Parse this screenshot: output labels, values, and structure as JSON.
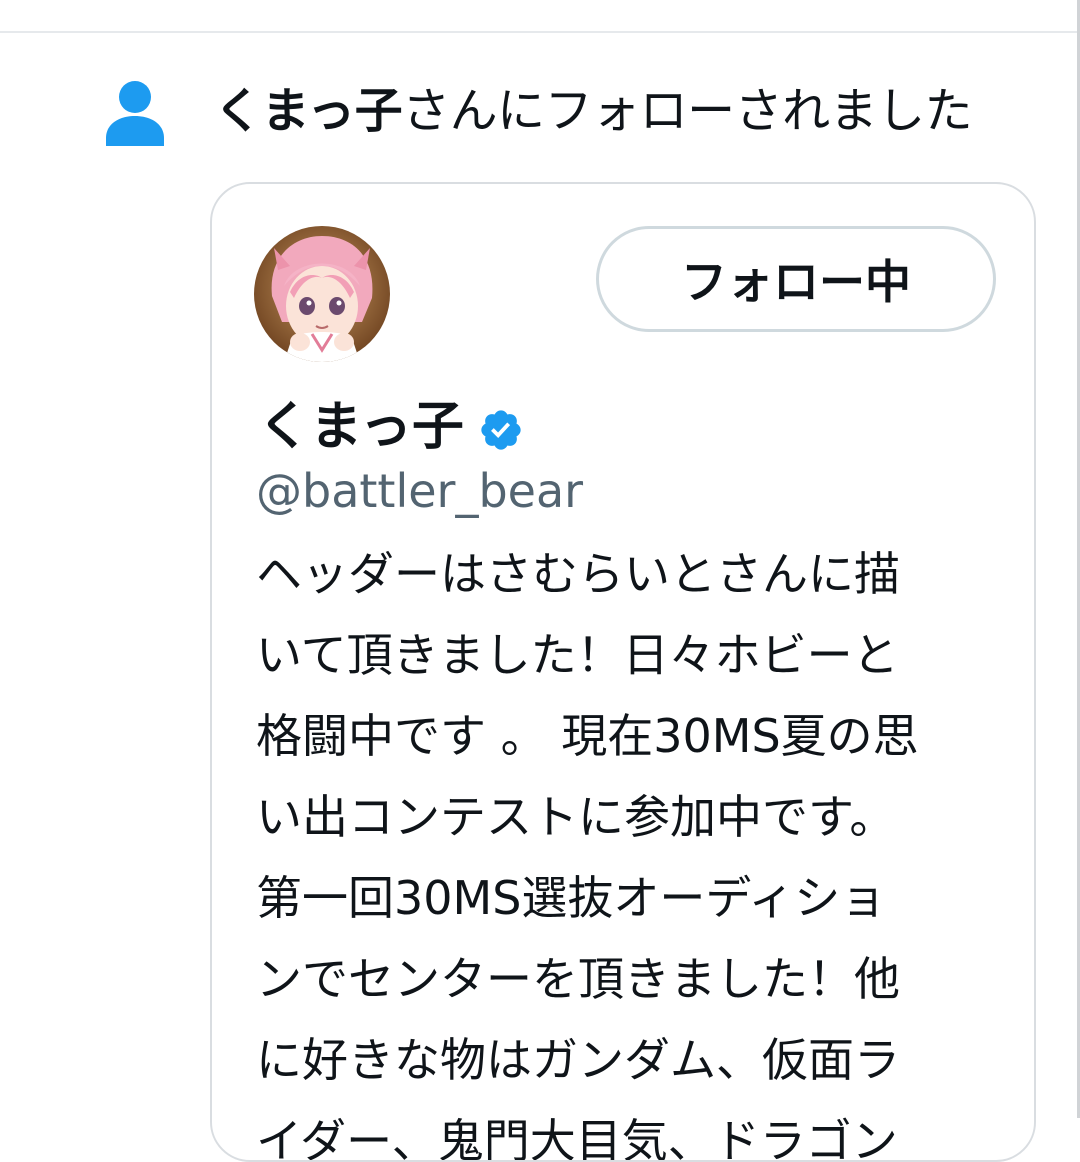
{
  "notification": {
    "name": "くまっ子",
    "message": "さんにフォローされました",
    "icon": "person-icon",
    "icon_color": "#1d9bf0"
  },
  "profile": {
    "display_name": "くまっ子",
    "verified_icon": "verified-badge-icon",
    "verified_color": "#1d9bf0",
    "handle": "@battler_bear",
    "follow_button_label": "フォロー中",
    "bio": "ヘッダーはさむらいとさんに描\nいて頂きました！日々ホビーと\n格闘中です 。 現在30MS夏の思\nい出コンテストに参加中です。\n第一回30MS選抜オーディショ\nンでセンターを頂きました！他\nに好きな物はガンダム、仮面ラ\nイダー、鬼門大目気、ドラゴン"
  }
}
